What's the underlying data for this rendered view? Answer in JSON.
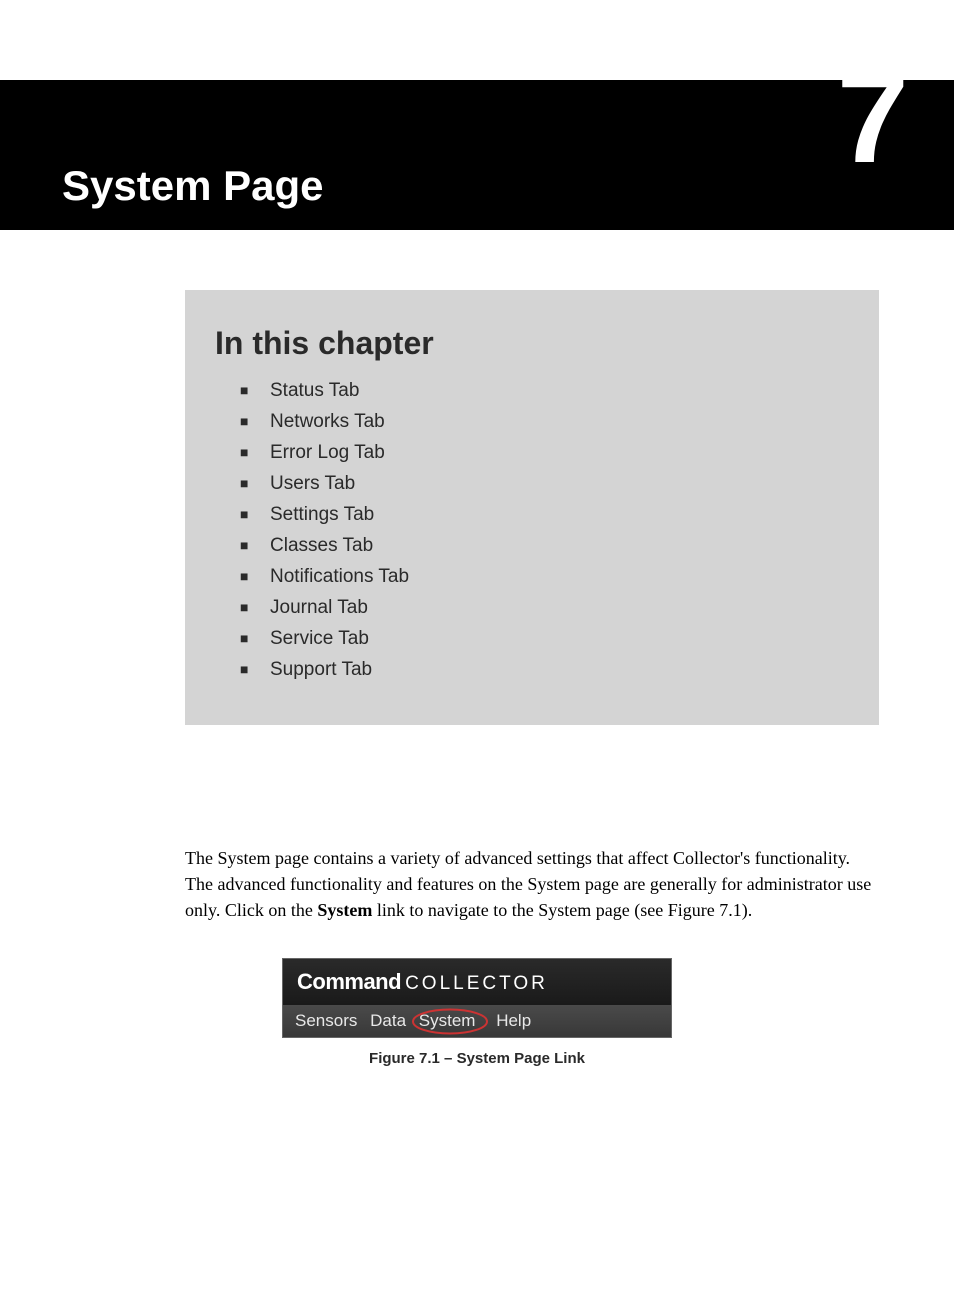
{
  "header": {
    "title": "System Page",
    "chapter_number": "7"
  },
  "chapter_box": {
    "title": "In this chapter",
    "items": [
      "Status Tab",
      "Networks Tab",
      "Error Log Tab",
      "Users Tab",
      "Settings Tab",
      "Classes Tab",
      "Notifications Tab",
      "Journal Tab",
      "Service Tab",
      "Support Tab"
    ]
  },
  "body": {
    "p1_a": "The System page contains a variety of advanced settings that affect Collector's functionality. The advanced functionality and features on the System page are generally for administrator use only. Click on the ",
    "p1_bold": "System",
    "p1_b": " link to navigate to the System page (see Figure 7.1)."
  },
  "figure": {
    "brand_bold": "Command",
    "brand_light": "COLLECTOR",
    "nav": {
      "sensors": "Sensors",
      "data": "Data",
      "system": "System",
      "help": "Help"
    },
    "caption": "Figure 7.1 – System Page Link"
  }
}
